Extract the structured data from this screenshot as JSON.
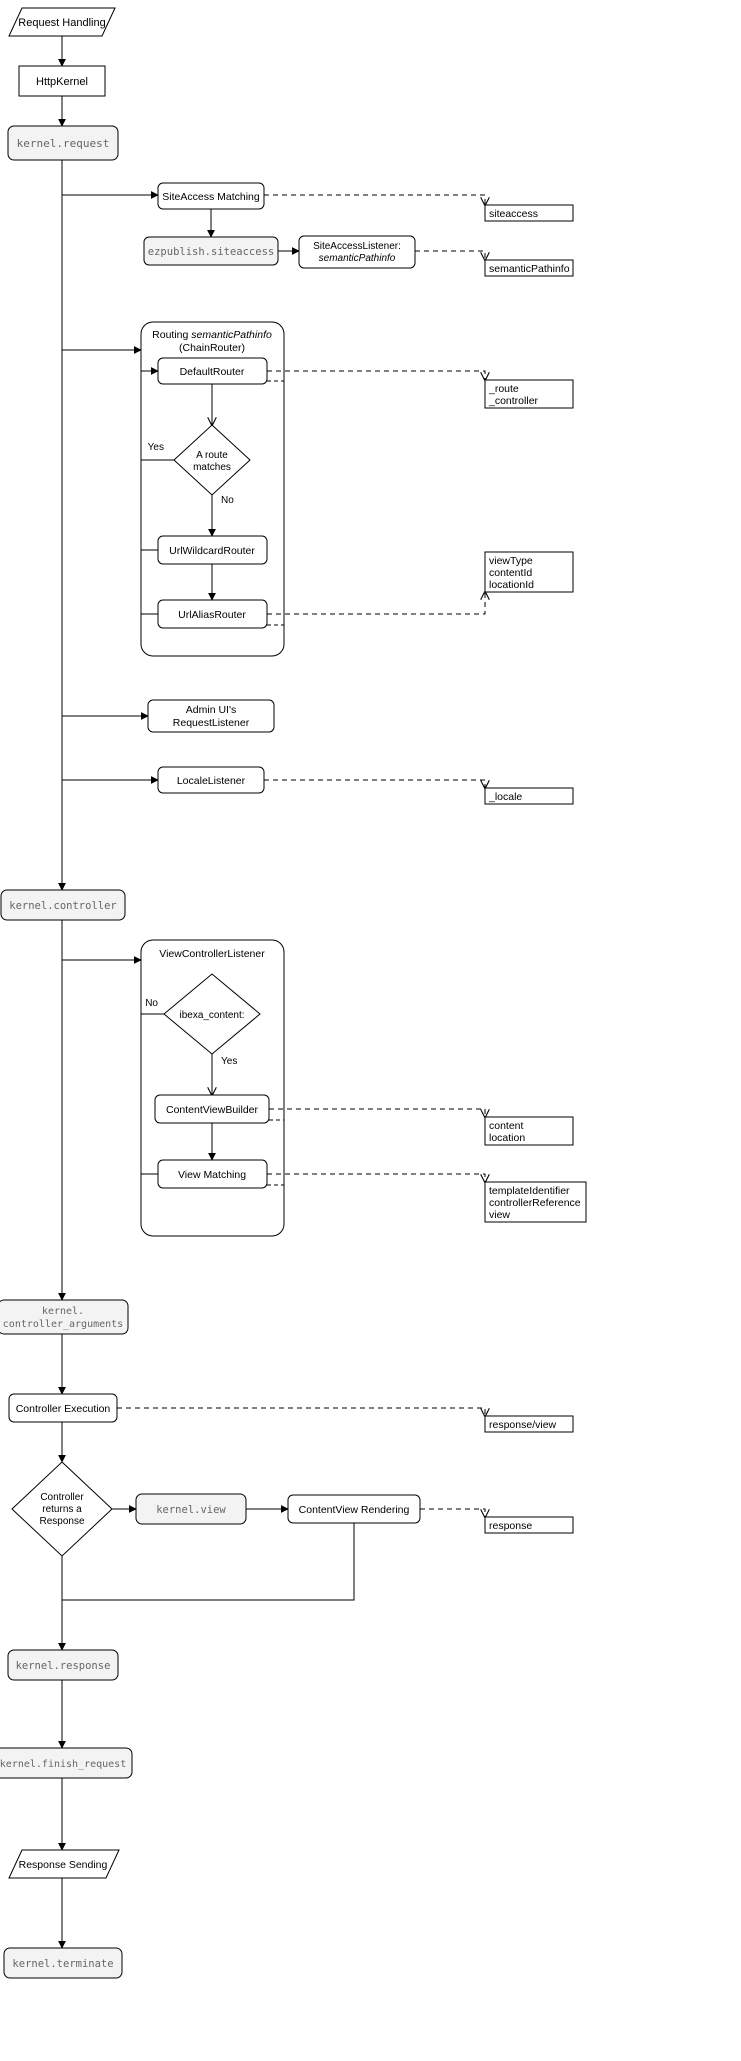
{
  "nodes": {
    "requestHandling": "Request Handling",
    "httpKernel": "HttpKernel",
    "kernelRequest": "kernel.request",
    "siteAccessMatching": "SiteAccess Matching",
    "ezSiteaccess": "ezpublish.siteaccess",
    "siteAccessListenerL1": "SiteAccessListener:",
    "siteAccessListenerL2": "semanticPathinfo",
    "routingTitleL1": "Routing ",
    "routingTitleItalic": "semanticPathinfo",
    "routingTitleL2": "(ChainRouter)",
    "defaultRouter": "DefaultRouter",
    "routeMatchesL1": "A route",
    "routeMatchesL2": "matches",
    "urlWildcardRouter": "UrlWildcardRouter",
    "urlAliasRouter": "UrlAliasRouter",
    "adminUiL1": "Admin UI's",
    "adminUiL2": "RequestListener",
    "localeListener": "LocaleListener",
    "kernelController": "kernel.controller",
    "viewControllerListener": "ViewControllerListener",
    "ibexaContent": "ibexa_content:",
    "contentViewBuilder": "ContentViewBuilder",
    "viewMatching": "View Matching",
    "kernelControllerArgsL1": "kernel.",
    "kernelControllerArgsL2": "controller_arguments",
    "controllerExecution": "Controller Execution",
    "controllerReturnsL1": "Controller",
    "controllerReturnsL2": "returns a",
    "controllerReturnsL3": "Response",
    "kernelView": "kernel.view",
    "contentViewRendering": "ContentView Rendering",
    "kernelResponse": "kernel.response",
    "kernelFinishRequest": "kernel.finish_request",
    "responseSending": "Response Sending",
    "kernelTerminate": "kernel.terminate"
  },
  "labels": {
    "yes1": "Yes",
    "no1": "No",
    "yes2": "Yes",
    "no2": "No"
  },
  "outputs": {
    "siteaccess": "siteaccess",
    "semanticPathinfo": "semanticPathinfo",
    "route": "_route",
    "controller": "_controller",
    "viewType": "viewType",
    "contentId": "contentId",
    "locationId": "locationId",
    "locale": "_locale",
    "content": "content",
    "location": "location",
    "templateIdentifier": "templateIdentifier",
    "controllerReference": "controllerReference",
    "view": "view",
    "responseView": "response/view",
    "response": "response"
  }
}
